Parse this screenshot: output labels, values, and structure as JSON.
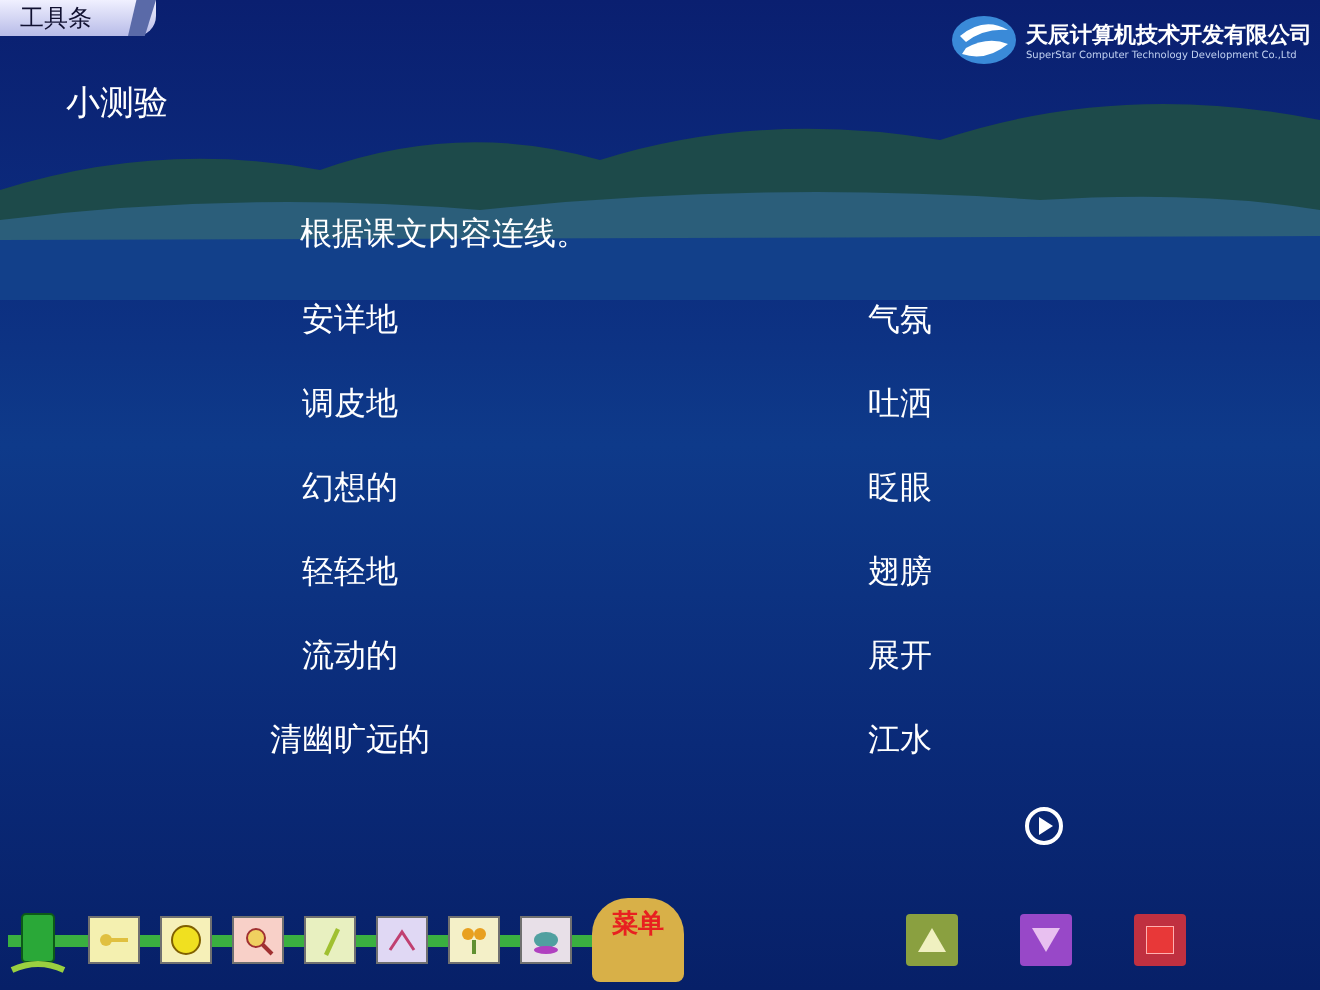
{
  "toolbar_tab": {
    "label": "工具条"
  },
  "company": {
    "name": "天辰计算机技术开发有限公司",
    "subtitle": "SuperStar Computer Technology Development Co.,Ltd"
  },
  "title": "小测验",
  "instruction": "根据课文内容连线。",
  "pairs": [
    {
      "left": "安详地",
      "right": "气氛"
    },
    {
      "left": "调皮地",
      "right": "吐洒"
    },
    {
      "left": "幻想的",
      "right": "眨眼"
    },
    {
      "left": "轻轻地",
      "right": "翅膀"
    },
    {
      "left": "流动的",
      "right": "展开"
    },
    {
      "left": "清幽旷远的",
      "right": "江水"
    }
  ],
  "menu_label": "菜单"
}
